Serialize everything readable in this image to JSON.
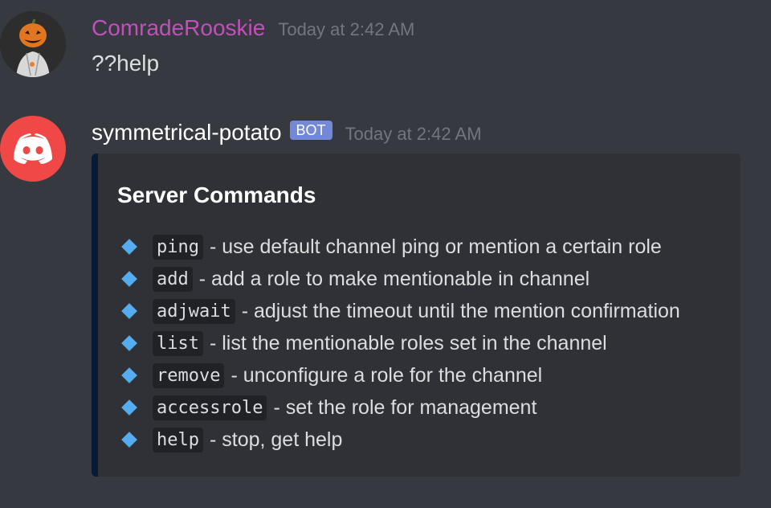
{
  "messages": [
    {
      "author": "ComradeRooskie",
      "timestamp": "Today at 2:42 AM",
      "content": "??help",
      "author_color": "#c34fbc",
      "avatar_icon": "pumpkin-head-avatar"
    },
    {
      "author": "symmetrical-potato",
      "tag": "BOT",
      "timestamp": "Today at 2:42 AM",
      "avatar_icon": "discord-logo",
      "embed": {
        "title": "Server Commands",
        "bar_color": "#071a36",
        "bullet_icon": "small-blue-diamond",
        "commands": [
          {
            "name": "ping",
            "desc": "- use default channel ping or mention a certain role"
          },
          {
            "name": "add",
            "desc": "- add a role to make mentionable in channel"
          },
          {
            "name": "adjwait",
            "desc": "- adjust the timeout until the mention confirmation"
          },
          {
            "name": "list",
            "desc": "- list the mentionable roles set in the channel"
          },
          {
            "name": "remove",
            "desc": "- unconfigure a role for the channel"
          },
          {
            "name": "accessrole",
            "desc": "- set the role for management"
          },
          {
            "name": "help",
            "desc": "- stop, get help"
          }
        ]
      }
    }
  ]
}
